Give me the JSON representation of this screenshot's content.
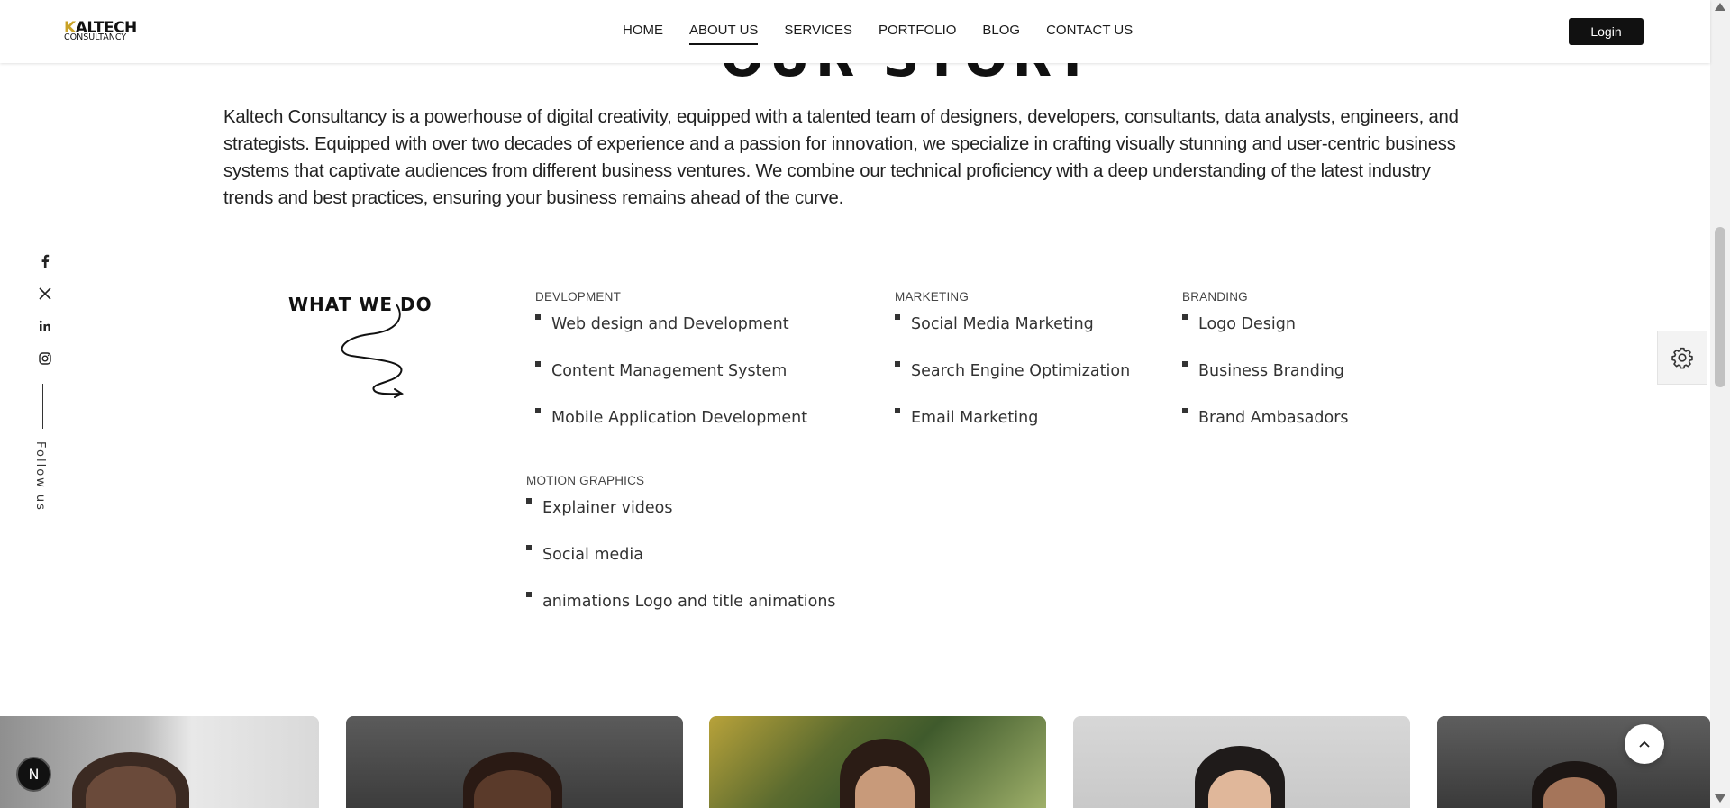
{
  "header": {
    "logo_top": "KALTECH",
    "logo_bottom": "CONSULTANCY",
    "nav": [
      {
        "label": "HOME"
      },
      {
        "label": "ABOUT US"
      },
      {
        "label": "SERVICES"
      },
      {
        "label": "PORTFOLIO"
      },
      {
        "label": "BLOG"
      },
      {
        "label": "CONTACT US"
      }
    ],
    "active_nav": "ABOUT US",
    "login_label": "Login"
  },
  "section": {
    "title": "OUR STORY",
    "intro": "Kaltech Consultancy is a powerhouse of digital creativity, equipped with a talented team of designers, developers, consultants, data analysts, engineers, and strategists. Equipped with over two decades of experience and a passion for innovation, we specialize in crafting visually stunning and user-centric business systems that captivate audiences from different business ventures. We combine our technical proficiency with a deep understanding of the latest industry trends and best practices, ensuring your business remains ahead of the curve."
  },
  "social": {
    "icons": [
      "facebook-icon",
      "x-icon",
      "linkedin-icon",
      "instagram-icon"
    ],
    "follow_label": "Follow us"
  },
  "what_we_do": {
    "title": "WHAT WE DO",
    "categories": [
      {
        "name": "DEVLOPMENT",
        "items": [
          "Web design and Development",
          "Content Management System",
          "Mobile Application Development"
        ]
      },
      {
        "name": "MARKETING",
        "items": [
          "Social Media Marketing",
          "Search Engine Optimization",
          "Email Marketing"
        ]
      },
      {
        "name": "BRANDING",
        "items": [
          "Logo Design",
          "Business Branding",
          "Brand Ambasadors"
        ]
      },
      {
        "name": "MOTION GRAPHICS",
        "items": [
          "Explainer videos",
          "Social media",
          "animations Logo and title animations"
        ]
      }
    ]
  },
  "widgets": {
    "badge_letter": "N"
  },
  "colors": {
    "accent": "#111111",
    "logo_accent": "#c9a227",
    "background": "#ffffff"
  }
}
